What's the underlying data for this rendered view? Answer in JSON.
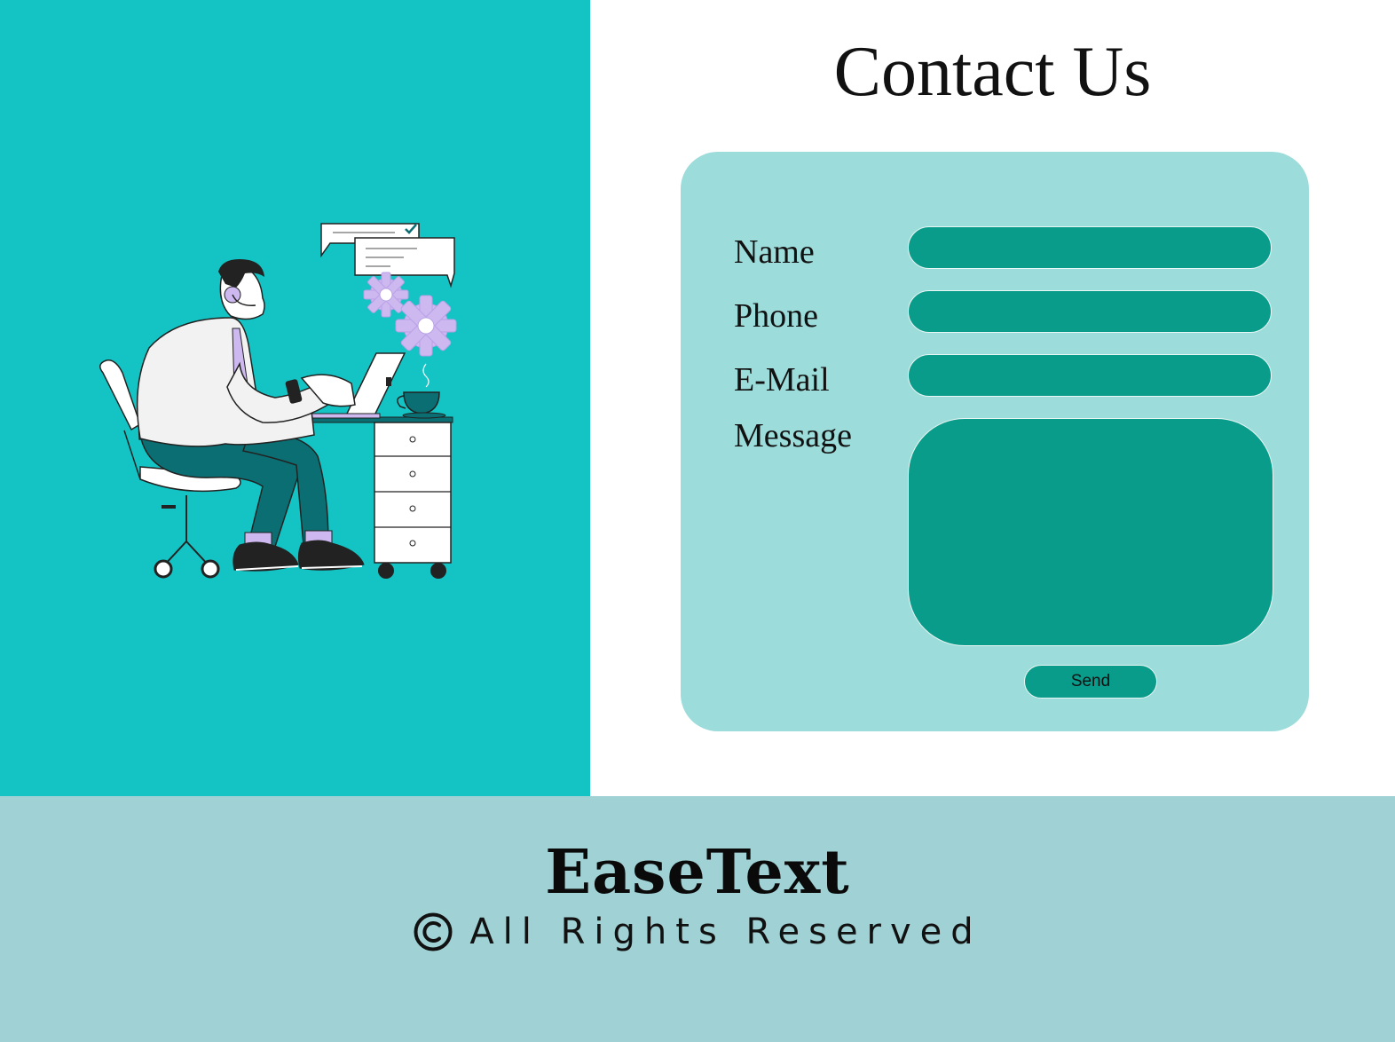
{
  "header": {
    "title": "Contact Us"
  },
  "form": {
    "fields": [
      {
        "label": "Name",
        "value": "",
        "placeholder": ""
      },
      {
        "label": "Phone",
        "value": "",
        "placeholder": ""
      },
      {
        "label": "E-Mail",
        "value": "",
        "placeholder": ""
      },
      {
        "label": "Message",
        "value": "",
        "placeholder": ""
      }
    ],
    "send_label": "Send"
  },
  "footer": {
    "brand": "EaseText",
    "rights": "All Rights Reserved",
    "icon": "copyright-icon"
  },
  "colors": {
    "left_panel": "#14c3c3",
    "form_card": "#9cdcda",
    "input_fill": "#0a9c8a",
    "footer": "#a0d1d4",
    "accent_lavender": "#cdb8f0",
    "pants_teal": "#0b6e72"
  }
}
